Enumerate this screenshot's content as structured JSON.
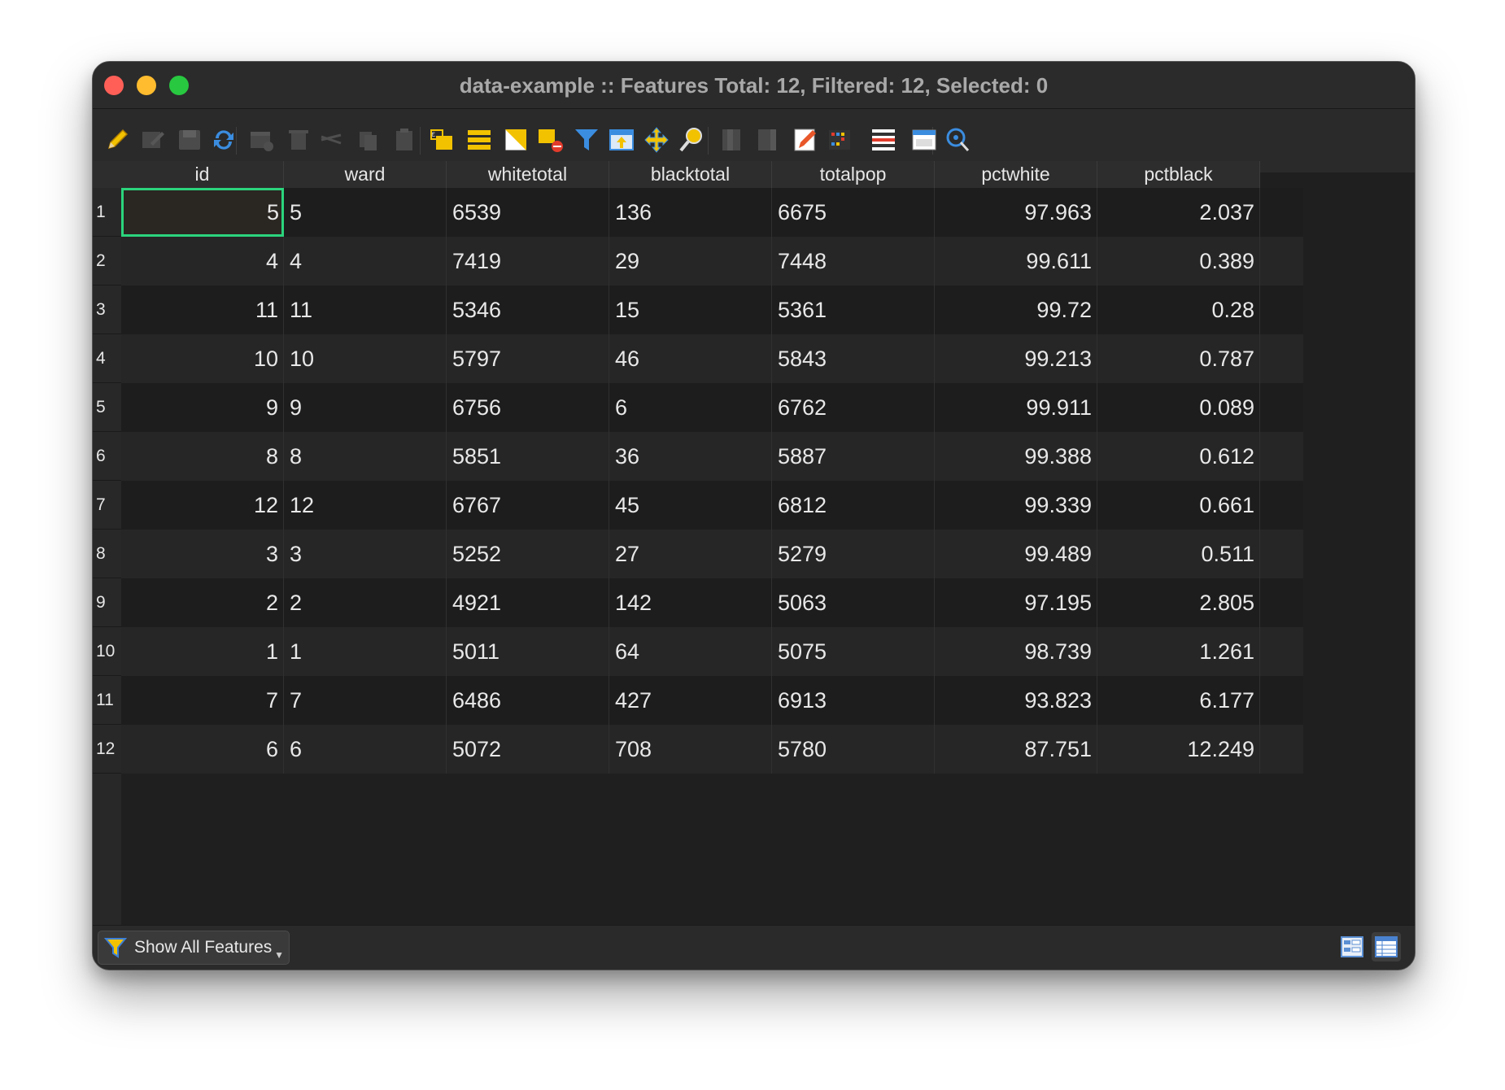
{
  "window": {
    "title": "data-example :: Features Total: 12, Filtered: 12, Selected: 0"
  },
  "toolbar": {
    "buttons": [
      {
        "icon": "pencil-edit-icon",
        "enabled": true
      },
      {
        "icon": "multi-edit-icon",
        "enabled": false
      },
      {
        "icon": "save-edits-icon",
        "enabled": false
      },
      {
        "icon": "reload-icon",
        "enabled": true
      },
      {
        "icon": "add-feature-icon",
        "enabled": false
      },
      {
        "icon": "delete-feature-icon",
        "enabled": false
      },
      {
        "icon": "cut-icon",
        "enabled": false
      },
      {
        "icon": "copy-icon",
        "enabled": false
      },
      {
        "icon": "paste-icon",
        "enabled": false
      },
      {
        "icon": "select-by-expression-icon",
        "enabled": true
      },
      {
        "icon": "select-all-icon",
        "enabled": true
      },
      {
        "icon": "invert-selection-icon",
        "enabled": true
      },
      {
        "icon": "deselect-all-icon",
        "enabled": true
      },
      {
        "icon": "filter-select-icon",
        "enabled": true
      },
      {
        "icon": "move-selection-to-top-icon",
        "enabled": true
      },
      {
        "icon": "pan-to-selection-icon",
        "enabled": true
      },
      {
        "icon": "zoom-to-selection-icon",
        "enabled": true
      },
      {
        "icon": "new-field-icon",
        "enabled": false
      },
      {
        "icon": "delete-field-icon",
        "enabled": false
      },
      {
        "icon": "field-calculator-icon",
        "enabled": true
      },
      {
        "icon": "conditional-formatting-icon",
        "enabled": true
      },
      {
        "icon": "organize-columns-icon",
        "enabled": true
      },
      {
        "icon": "dock-table-icon",
        "enabled": true
      },
      {
        "icon": "actions-icon",
        "enabled": true
      }
    ]
  },
  "table": {
    "columns": [
      "id",
      "ward",
      "whitetotal",
      "blacktotal",
      "totalpop",
      "pctwhite",
      "pctblack"
    ],
    "row_numbers": [
      "1",
      "2",
      "3",
      "4",
      "5",
      "6",
      "7",
      "8",
      "9",
      "10",
      "11",
      "12"
    ],
    "rows": [
      [
        "5",
        "5",
        "6539",
        "136",
        "6675",
        "97.963",
        "2.037"
      ],
      [
        "4",
        "4",
        "7419",
        "29",
        "7448",
        "99.611",
        "0.389"
      ],
      [
        "11",
        "11",
        "5346",
        "15",
        "5361",
        "99.72",
        "0.28"
      ],
      [
        "10",
        "10",
        "5797",
        "46",
        "5843",
        "99.213",
        "0.787"
      ],
      [
        "9",
        "9",
        "6756",
        "6",
        "6762",
        "99.911",
        "0.089"
      ],
      [
        "8",
        "8",
        "5851",
        "36",
        "5887",
        "99.388",
        "0.612"
      ],
      [
        "12",
        "12",
        "6767",
        "45",
        "6812",
        "99.339",
        "0.661"
      ],
      [
        "3",
        "3",
        "5252",
        "27",
        "5279",
        "99.489",
        "0.511"
      ],
      [
        "2",
        "2",
        "4921",
        "142",
        "5063",
        "97.195",
        "2.805"
      ],
      [
        "1",
        "1",
        "5011",
        "64",
        "5075",
        "98.739",
        "1.261"
      ],
      [
        "7",
        "7",
        "6486",
        "427",
        "6913",
        "93.823",
        "6.177"
      ],
      [
        "6",
        "6",
        "5072",
        "708",
        "5780",
        "87.751",
        "12.249"
      ]
    ],
    "selected_cell": {
      "row": 0,
      "col": 0
    },
    "selection_color": "#2bd47c"
  },
  "statusbar": {
    "filter_label": "Show All Features",
    "view_modes": [
      "form-view-icon",
      "table-view-icon"
    ],
    "active_view": "table-view-icon"
  }
}
